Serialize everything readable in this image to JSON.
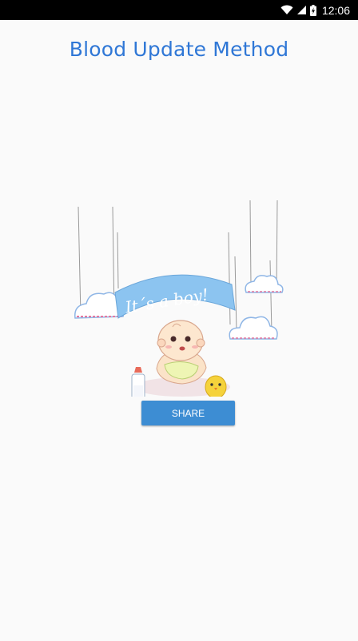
{
  "status_bar": {
    "time": "12:06"
  },
  "header": {
    "title": "Blood Update Method"
  },
  "illustration": {
    "banner_text": "It´s a  boy!"
  },
  "actions": {
    "share_label": "SHARE"
  },
  "colors": {
    "title": "#2f77d6",
    "button": "#3d8dd3",
    "banner": "#8cc4f0"
  }
}
